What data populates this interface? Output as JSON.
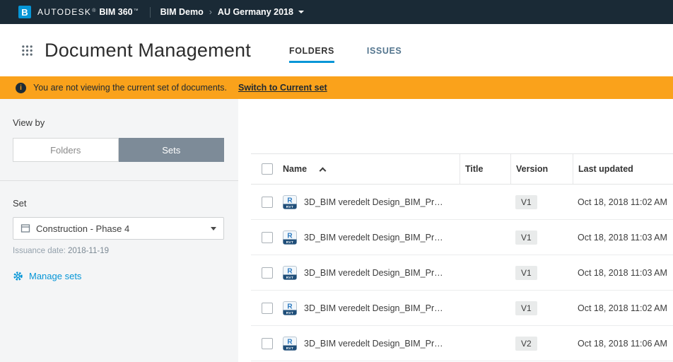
{
  "topbar": {
    "logo_letter": "B",
    "brand": {
      "autodesk": "AUTODESK",
      "autodesk_mark": "®",
      "product": "BIM 360",
      "product_mark": "™"
    },
    "breadcrumb": {
      "project": "BIM Demo",
      "separator": "›",
      "set": "AU Germany 2018"
    }
  },
  "header": {
    "title": "Document Management",
    "tabs": [
      {
        "label": "FOLDERS",
        "active": true
      },
      {
        "label": "ISSUES",
        "active": false
      }
    ]
  },
  "banner": {
    "message": "You are not viewing the current set of documents.",
    "link_label": "Switch to Current set"
  },
  "sidebar": {
    "view_by_label": "View by",
    "toggle": {
      "folders_label": "Folders",
      "sets_label": "Sets",
      "selected": "Sets"
    },
    "set_label": "Set",
    "set_dropdown_value": "Construction - Phase 4",
    "issuance_label": "Issuance date:",
    "issuance_value": "2018-11-19",
    "manage_sets_label": "Manage sets"
  },
  "table": {
    "columns": {
      "name": "Name",
      "title": "Title",
      "version": "Version",
      "last_updated": "Last updated"
    },
    "sort": {
      "column": "Name",
      "direction": "ascending"
    },
    "rows": [
      {
        "name": "3D_BIM veredelt Design_BIM_Pr…",
        "title": "",
        "version": "V1",
        "last_updated": "Oct 18, 2018 11:02 AM",
        "file_type": "revit"
      },
      {
        "name": "3D_BIM veredelt Design_BIM_Pr…",
        "title": "",
        "version": "V1",
        "last_updated": "Oct 18, 2018 11:03 AM",
        "file_type": "revit"
      },
      {
        "name": "3D_BIM veredelt Design_BIM_Pr…",
        "title": "",
        "version": "V1",
        "last_updated": "Oct 18, 2018 11:03 AM",
        "file_type": "revit"
      },
      {
        "name": "3D_BIM veredelt Design_BIM_Pr…",
        "title": "",
        "version": "V1",
        "last_updated": "Oct 18, 2018 11:02 AM",
        "file_type": "revit"
      },
      {
        "name": "3D_BIM veredelt Design_BIM_Pr…",
        "title": "",
        "version": "V2",
        "last_updated": "Oct 18, 2018 11:06 AM",
        "file_type": "revit"
      }
    ]
  },
  "icons": {
    "apps_grid": "grid-9-dots",
    "info": "i",
    "revit_file_letter": "R",
    "revit_file_label": "RVT"
  },
  "colors": {
    "accent_blue": "#0696d7",
    "topbar_bg": "#1a2a36",
    "banner_bg": "#faa21b",
    "selected_toggle_bg": "#7d8b98"
  }
}
